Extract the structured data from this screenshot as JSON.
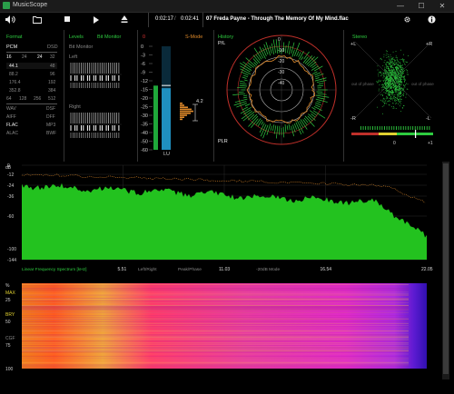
{
  "window": {
    "title": "MusicScope",
    "minimize": "—",
    "maximize": "☐",
    "close": "✕"
  },
  "toolbar": {
    "time_current": "0:02:17",
    "time_total": "0:02:41",
    "track": "07 Freda Payne - Through The Memory Of My Mind.flac",
    "icons": [
      "volume-icon",
      "open-folder-icon",
      "stop-icon",
      "play-icon",
      "eject-icon",
      "settings-icon",
      "info-icon"
    ]
  },
  "format": {
    "title": "Format",
    "pcm": "PCM",
    "dsd": "DSD",
    "bits": [
      "16",
      "24",
      "32"
    ],
    "rates": [
      [
        "44.1",
        "48"
      ],
      [
        "88.2",
        "96"
      ],
      [
        "176.4",
        "192"
      ],
      [
        "352.8",
        "384"
      ]
    ],
    "dsd_rates": [
      "64",
      "128",
      "256",
      "512"
    ],
    "codecs": [
      [
        "WAV",
        "DSF"
      ],
      [
        "AIFF",
        "DFF"
      ],
      [
        "FLAC",
        "MP3"
      ],
      [
        "ALAC",
        "BWF"
      ]
    ],
    "selected_bits": "16",
    "selected_rate": "44.1",
    "selected_codec": "FLAC"
  },
  "levels": {
    "title": "Levels",
    "mode": "Bit Monitor",
    "sub": "Bit Monitor",
    "left": "Left",
    "right": "Right"
  },
  "meter": {
    "title_left": "0",
    "title_right": "S-Mode",
    "scale": [
      "0",
      "-3",
      "-6",
      "-9",
      "-12",
      "-15",
      "-20",
      "-25",
      "-30",
      "-35",
      "-40",
      "-50",
      "-60"
    ],
    "lu_label": "LU",
    "peak_value": "4.2",
    "level_fraction": 0.62
  },
  "history": {
    "title": "History",
    "pl": "P/L",
    "plr": "PLR",
    "rings": [
      "0",
      "-10",
      "-20",
      "-30",
      "-40"
    ]
  },
  "stereo": {
    "title": "Stereo",
    "plus_l": "+L",
    "plus_r": "+R",
    "minus_l": "-R",
    "minus_r": "-L",
    "out_phase_l": "out of phase",
    "out_phase_r": "out of phase",
    "corr_min": "-1",
    "corr_mid": "0",
    "corr_max": "+1"
  },
  "spectrum": {
    "db_ticks": [
      "0",
      "-12",
      "-24",
      "-36",
      "-60",
      "-100",
      "-144"
    ],
    "db_unit": "dB",
    "freq_ticks": [
      "5.51",
      "11.03",
      "16.54",
      "22.05"
    ],
    "footer": [
      "Linear Frequency Spectrum [kHz]",
      "Left/Right",
      "Peak/Phase",
      "-20dB Mode"
    ]
  },
  "spectrogram": {
    "pct_unit": "%",
    "ticks": [
      "MAX",
      "25",
      "BRY",
      "50",
      "CGF",
      "75",
      "100"
    ],
    "pct_ticks": [
      "25",
      "50",
      "75",
      "100"
    ]
  }
}
